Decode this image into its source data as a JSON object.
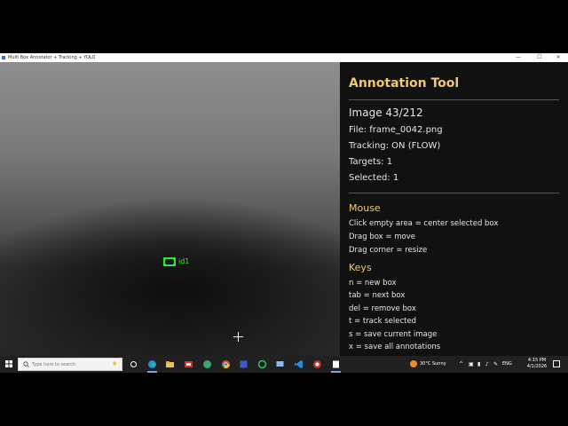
{
  "window": {
    "title": "Multi Box Annotator + Tracking + YOLO",
    "minimize_glyph": "—",
    "maximize_glyph": "☐",
    "close_glyph": "✕"
  },
  "canvas": {
    "box_label": "id1"
  },
  "panel": {
    "title": "Annotation Tool",
    "image": "Image 43/212",
    "file": "File: frame_0042.png",
    "tracking": "Tracking: ON (FLOW)",
    "targets": "Targets: 1",
    "selected": "Selected: 1",
    "mouse_heading": "Mouse",
    "mouse_lines": [
      "Click empty area = center selected box",
      "Drag box = move",
      "Drag corner = resize"
    ],
    "keys_heading": "Keys",
    "key_lines": [
      "n = new box",
      "tab = next box",
      "del = remove box",
      "t = track selected",
      "s = save current image",
      "x = save all annotations"
    ]
  },
  "taskbar": {
    "search_placeholder": "Type here to search",
    "weather": "30°C Sunny",
    "lang": "ENG",
    "time": "4:15 PM",
    "date": "4/1/2026",
    "colors": {
      "accent": "#6fa8e8",
      "background": "#202020"
    }
  },
  "colors": {
    "panel_heading": "#f2c96b",
    "bbox": "#2ee82e",
    "panel_bg": "#111111"
  }
}
